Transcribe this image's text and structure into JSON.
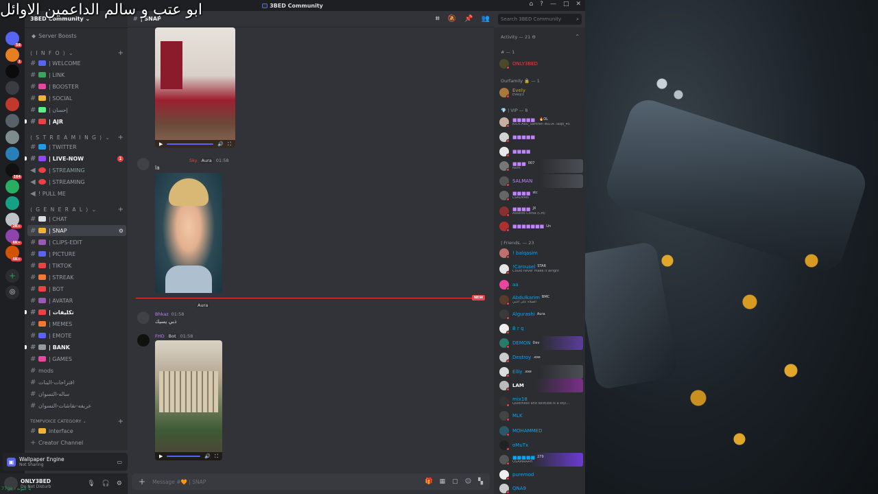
{
  "overlay_text": "ابو عتب و سالم الداعمين الاوائل",
  "window": {
    "title": "3BED Community",
    "controls": [
      "⌂",
      "?",
      "—",
      "□",
      "✕"
    ]
  },
  "server": {
    "name": "3BED Community",
    "boosts_label": "Server Boosts"
  },
  "categories": [
    {
      "label": "⟨ I N F O ⟩ ⌄"
    },
    {
      "label": "⟨ S T R E A M I N G ⟩ ⌄"
    },
    {
      "label": "⟨ G E N E R A L ⟩ ⌄"
    },
    {
      "label": "TEMPVOICE CATEGORY ⌄"
    }
  ],
  "channels": {
    "info": [
      {
        "label": "| WELCOME",
        "color": "#5865f2"
      },
      {
        "label": "| LINK",
        "color": "#3ba55c"
      },
      {
        "label": "| BOOSTER",
        "color": "#eb459e"
      },
      {
        "label": "| SOCIAL",
        "color": "#f0b232"
      },
      {
        "label": "| إحسان",
        "color": "#57f287"
      },
      {
        "label": "| AJR",
        "color": "#ed4245"
      }
    ],
    "streaming": [
      {
        "label": "| TWITTER",
        "color": "#1d9bf0"
      },
      {
        "label": "| LIVE-NOW",
        "color": "#9146ff",
        "badge": "1"
      },
      {
        "label": "| STREAMING",
        "color": "#ed4245"
      },
      {
        "label": "| STREAMING",
        "color": "#ed4245"
      },
      {
        "label": "! PULL ME",
        "color": "#949ba4"
      }
    ],
    "general": [
      {
        "label": "| CHAT",
        "color": "#dbdee1"
      },
      {
        "label": "| SNAP",
        "color": "#f0b232"
      },
      {
        "label": "| CLIPS-EDIT",
        "color": "#9b59b6"
      },
      {
        "label": "| PICTURE",
        "color": "#5865f2"
      },
      {
        "label": "| TIKTOK",
        "color": "#ed4245"
      },
      {
        "label": "| STREAK",
        "color": "#f57731"
      },
      {
        "label": "| BOT",
        "color": "#ed4245"
      },
      {
        "label": "| AVATAR",
        "color": "#9b59b6"
      },
      {
        "label": "| تكليفات",
        "color": "#ed4245"
      },
      {
        "label": "| MEMES",
        "color": "#f57731"
      },
      {
        "label": "| EMOTE",
        "color": "#5865f2"
      },
      {
        "label": "| BANK",
        "color": "#949ba4"
      },
      {
        "label": "| GAMES",
        "color": "#eb459e"
      },
      {
        "label": "mods",
        "color": ""
      },
      {
        "label": "اقتراحات-البنات",
        "color": ""
      },
      {
        "label": "ساله-النسوان",
        "color": ""
      },
      {
        "label": "عريفه-نقاشات-النسوان",
        "color": ""
      }
    ],
    "tempvoice": [
      {
        "label": "interface",
        "color": "#f0b232"
      },
      {
        "label": "Creator Channel",
        "color": "#5865f2"
      }
    ]
  },
  "activity": {
    "title": "Wallpaper Engine",
    "subtitle": "Not Sharing"
  },
  "user": {
    "name": "ONLY3BED",
    "status": "Do Not Disturb",
    "footer": "77ge : يا عيونه"
  },
  "chat": {
    "channel_name": "| SNAP",
    "composer_placeholder": "Message #🧡 | SNAP"
  },
  "search": {
    "placeholder": "Search 3BED Community"
  },
  "messages": [
    {
      "author": "Sky",
      "tag": "Aura",
      "time": "01:58",
      "text": "la"
    },
    {
      "author": "Bhkaz",
      "tag": "Aura",
      "time": "01:58",
      "text": "ذبي يسيك"
    },
    {
      "author": "FHD",
      "tag": "Bot",
      "time": "01:58",
      "text": ""
    }
  ],
  "new_label": "NEW",
  "member_groups": [
    {
      "label": "Activity — 21 ⚙"
    },
    {
      "label": "# — 1"
    },
    {
      "label": "Ourfamily 🔒 — 1"
    },
    {
      "label": "💎 | VIP — 8"
    },
    {
      "label": "| Friends. — 23"
    }
  ],
  "members": [
    {
      "name": "ONLY3BED",
      "color": "#f23f43",
      "sub": "",
      "tag": ""
    },
    {
      "name": "Evely",
      "color": "#c9a227",
      "sub": "Evely3",
      "tag": ""
    },
    {
      "name": "OL",
      "color": "#c084fc",
      "sub": "KICK:Abu_Samrah INSTA :Iaqd_45",
      "tag": "🔥OL"
    },
    {
      "name": "",
      "color": "#c084fc",
      "sub": "",
      "tag": ""
    },
    {
      "name": "",
      "color": "#c084fc",
      "sub": "",
      "tag": ""
    },
    {
      "name": "",
      "color": "#c084fc",
      "sub": "Nvm",
      "tag": "007"
    },
    {
      "name": "SALMAN",
      "color": "#c084fc",
      "sub": "",
      "tag": ""
    },
    {
      "name": "",
      "color": "#c084fc",
      "sub": "LSALMAN",
      "tag": "stc"
    },
    {
      "name": "",
      "color": "#c084fc",
      "sub": "Assetto Corsa (CM)",
      "tag": "JX"
    },
    {
      "name": "",
      "color": "#c084fc",
      "sub": "",
      "tag": "Un"
    },
    {
      "name": "! balqasim",
      "color": "#00a8fc",
      "sub": "",
      "tag": ""
    },
    {
      "name": "!Carousel",
      "color": "#00a8fc",
      "sub": "Could never make it alright",
      "tag": "STAR"
    },
    {
      "name": "aa",
      "color": "#00a8fc",
      "sub": "",
      "tag": ""
    },
    {
      "name": "Abdulkarim",
      "color": "#00a8fc",
      "sub": "الصلاة على النبي",
      "tag": "BMC"
    },
    {
      "name": "Algurashi",
      "color": "#00a8fc",
      "sub": "",
      "tag": "Aura"
    },
    {
      "name": "B r q",
      "color": "#00a8fc",
      "sub": "",
      "tag": ""
    },
    {
      "name": "DEMON",
      "color": "#00a8fc",
      "sub": "",
      "tag": "Dev"
    },
    {
      "name": "Destroy",
      "color": "#00a8fc",
      "sub": "",
      "tag": ".exe"
    },
    {
      "name": "Ellly",
      "color": "#00a8fc",
      "sub": "",
      "tag": ".exe"
    },
    {
      "name": "LAM",
      "color": "#ffffff",
      "sub": "",
      "tag": ""
    },
    {
      "name": "mix18",
      "color": "#00a8fc",
      "sub": "Quietness and solitude is a styl...",
      "tag": ""
    },
    {
      "name": "MLK",
      "color": "#00a8fc",
      "sub": "",
      "tag": ""
    },
    {
      "name": "MOHAMMED",
      "color": "#00a8fc",
      "sub": "",
      "tag": ""
    },
    {
      "name": "oMuTx",
      "color": "#00a8fc",
      "sub": "",
      "tag": ""
    },
    {
      "name": "",
      "color": "#00a8fc",
      "sub": "OSAMAAAH",
      "tag": "279"
    },
    {
      "name": "puremod",
      "color": "#00a8fc",
      "sub": "",
      "tag": ""
    },
    {
      "name": "QNA9",
      "color": "#00a8fc",
      "sub": "",
      "tag": ""
    }
  ],
  "guild_badges": [
    "58",
    "1",
    "164",
    "2K+",
    "6K+",
    "6K+"
  ]
}
